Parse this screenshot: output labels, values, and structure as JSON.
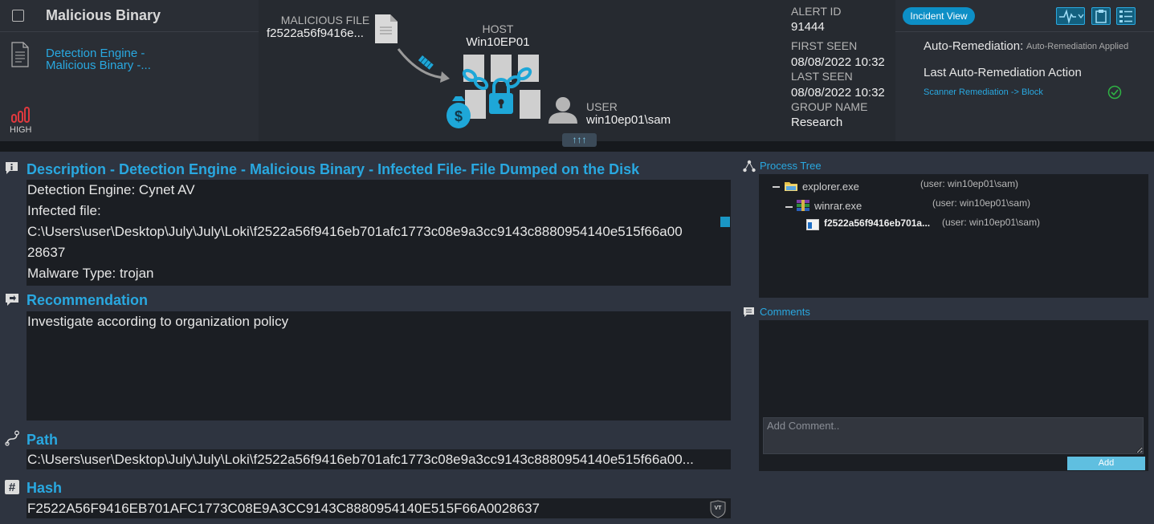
{
  "header": {
    "alert_title": "Malicious Binary",
    "engine_link": "Detection Engine - Malicious Binary -...",
    "severity": "HIGH",
    "malicious_file_label": "MALICIOUS FILE",
    "malicious_file_value": "f2522a56f9416e...",
    "host_label": "HOST",
    "host_value": "Win10EP01",
    "user_label": "USER",
    "user_value": "win10ep01\\sam",
    "collapse_arrows": "↑↑↑"
  },
  "meta": {
    "alert_id_label": "ALERT ID",
    "alert_id": "91444",
    "first_seen_label": "FIRST SEEN",
    "first_seen": "08/08/2022 10:32",
    "last_seen_label": "LAST SEEN",
    "last_seen": "08/08/2022 10:32",
    "group_name_label": "GROUP NAME",
    "group_name": "Research"
  },
  "right_panel": {
    "incident_view": "Incident View",
    "auto_remediation_label": "Auto-Remediation:",
    "auto_remediation_value": "Auto-Remediation Applied",
    "last_action_label": "Last Auto-Remediation Action",
    "last_action_value": "Scanner Remediation -> Block",
    "toolbar_icons": [
      "activity-icon",
      "clipboard-icon",
      "list-icon"
    ]
  },
  "description": {
    "title": "Description - Detection Engine - Malicious Binary - Infected File- File Dumped on the Disk",
    "lines": [
      "Detection Engine: Cynet AV",
      "Infected file:",
      "C:\\Users\\user\\Desktop\\July\\July\\Loki\\f2522a56f9416eb701afc1773c08e9a3cc9143c8880954140e515f66a00",
      "28637",
      "Malware Type: trojan"
    ]
  },
  "recommendation": {
    "title": "Recommendation",
    "text": "Investigate according to organization policy"
  },
  "path": {
    "title": "Path",
    "value": "C:\\Users\\user\\Desktop\\July\\July\\Loki\\f2522a56f9416eb701afc1773c08e9a3cc9143c8880954140e515f66a00..."
  },
  "hash": {
    "title": "Hash",
    "value": "F2522A56F9416EB701AFC1773C08E9A3CC9143C8880954140E515F66A0028637",
    "vt_badge": "VT"
  },
  "process_tree": {
    "title": "Process Tree",
    "nodes": [
      {
        "name": "explorer.exe",
        "user": "(user: win10ep01\\sam)"
      },
      {
        "name": "winrar.exe",
        "user": "(user: win10ep01\\sam)"
      },
      {
        "name": "f2522a56f9416eb701a...",
        "user": "(user: win10ep01\\sam)"
      }
    ]
  },
  "comments": {
    "title": "Comments",
    "placeholder": "Add Comment..",
    "add_label": "Add"
  },
  "colors": {
    "accent": "#29a8e0",
    "header_bg": "#262a30",
    "body_bg": "#2e3440",
    "box_bg": "#1b1e23",
    "severity_red": "#e0393e",
    "success_green": "#2fb344"
  }
}
